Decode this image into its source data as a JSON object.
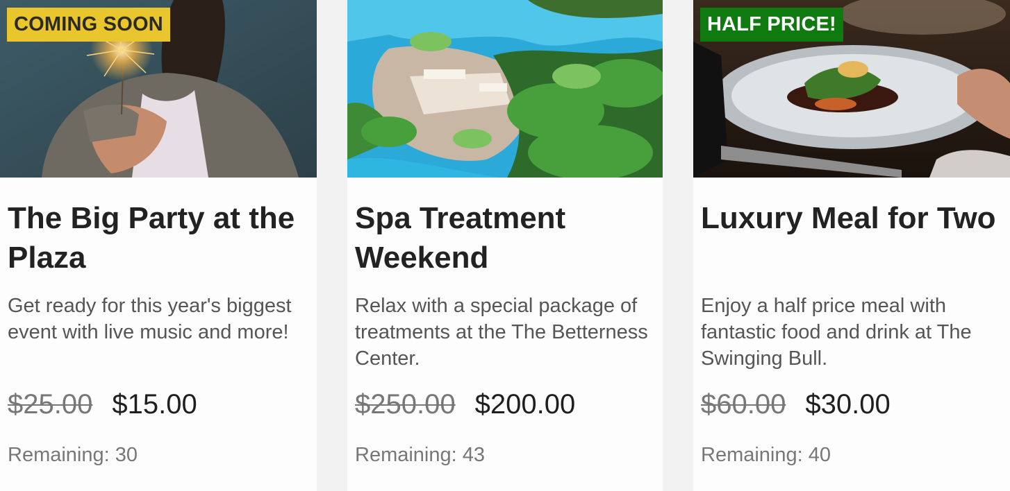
{
  "cards": [
    {
      "badge": "COMING SOON",
      "badge_color": "#e9c62e",
      "image_subject": "woman holding sparkler",
      "title": "The Big Party at the Plaza",
      "description": "Get ready for this year's biggest event with live music and more!",
      "old_price": "$25.00",
      "new_price": "$15.00",
      "remaining": "Remaining: 30"
    },
    {
      "badge": "",
      "image_subject": "resort pool with palm trees",
      "title": "Spa Treatment Weekend",
      "description": "Relax with a special package of treatments at the The Betterness Center.",
      "old_price": "$250.00",
      "new_price": "$200.00",
      "remaining": "Remaining: 43"
    },
    {
      "badge": "HALF PRICE!",
      "badge_color": "#0f7a0f",
      "image_subject": "plated gourmet meal",
      "title": "Luxury Meal for Two",
      "description": "Enjoy a half price meal with fantastic food and drink at The Swinging Bull.",
      "old_price": "$60.00",
      "new_price": "$30.00",
      "remaining": "Remaining: 40"
    }
  ]
}
